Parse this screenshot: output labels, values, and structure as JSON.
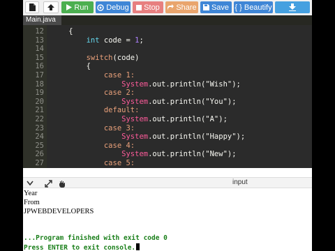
{
  "toolbar": {
    "file_icon": "file-icon",
    "upload_icon": "upload-icon",
    "run_label": "Run",
    "debug_label": "Debug",
    "stop_label": "Stop",
    "share_label": "Share",
    "save_label": "Save",
    "beautify_label": "{ } Beautify",
    "download_icon": "download-icon"
  },
  "editor": {
    "tab": "Main.java",
    "lines": [
      {
        "n": "12",
        "tokens": [
          {
            "t": "    {",
            "c": ""
          }
        ]
      },
      {
        "n": "13",
        "tokens": [
          {
            "t": "        ",
            "c": ""
          },
          {
            "t": "int",
            "c": "kw"
          },
          {
            "t": " code = ",
            "c": ""
          },
          {
            "t": "1",
            "c": "num"
          },
          {
            "t": ";",
            "c": ""
          }
        ]
      },
      {
        "n": "14",
        "tokens": [
          {
            "t": "",
            "c": ""
          }
        ]
      },
      {
        "n": "15",
        "tokens": [
          {
            "t": "        ",
            "c": ""
          },
          {
            "t": "switch",
            "c": "ctl2"
          },
          {
            "t": "(code)",
            "c": ""
          }
        ]
      },
      {
        "n": "16",
        "tokens": [
          {
            "t": "        {",
            "c": ""
          }
        ]
      },
      {
        "n": "17",
        "tokens": [
          {
            "t": "            ",
            "c": ""
          },
          {
            "t": "case 1:",
            "c": "ctl2"
          }
        ]
      },
      {
        "n": "18",
        "tokens": [
          {
            "t": "                ",
            "c": ""
          },
          {
            "t": "System",
            "c": "cls"
          },
          {
            "t": ".out.println(",
            "c": ""
          },
          {
            "t": "\"Wish\"",
            "c": ""
          },
          {
            "t": ");",
            "c": ""
          }
        ]
      },
      {
        "n": "19",
        "tokens": [
          {
            "t": "            ",
            "c": ""
          },
          {
            "t": "case 2:",
            "c": "ctl2"
          }
        ]
      },
      {
        "n": "20",
        "tokens": [
          {
            "t": "                ",
            "c": ""
          },
          {
            "t": "System",
            "c": "cls"
          },
          {
            "t": ".out.println(",
            "c": ""
          },
          {
            "t": "\"You\"",
            "c": ""
          },
          {
            "t": ");",
            "c": ""
          }
        ]
      },
      {
        "n": "21",
        "tokens": [
          {
            "t": "            ",
            "c": ""
          },
          {
            "t": "default:",
            "c": "ctl2"
          }
        ]
      },
      {
        "n": "22",
        "tokens": [
          {
            "t": "                ",
            "c": ""
          },
          {
            "t": "System",
            "c": "cls"
          },
          {
            "t": ".out.println(",
            "c": ""
          },
          {
            "t": "\"A\"",
            "c": ""
          },
          {
            "t": ");",
            "c": ""
          }
        ]
      },
      {
        "n": "23",
        "tokens": [
          {
            "t": "            ",
            "c": ""
          },
          {
            "t": "case 3:",
            "c": "ctl2"
          }
        ]
      },
      {
        "n": "24",
        "tokens": [
          {
            "t": "                ",
            "c": ""
          },
          {
            "t": "System",
            "c": "cls"
          },
          {
            "t": ".out.println(",
            "c": ""
          },
          {
            "t": "\"Happy\"",
            "c": ""
          },
          {
            "t": ");",
            "c": ""
          }
        ]
      },
      {
        "n": "25",
        "tokens": [
          {
            "t": "            ",
            "c": ""
          },
          {
            "t": "case 4:",
            "c": "ctl2"
          }
        ]
      },
      {
        "n": "26",
        "tokens": [
          {
            "t": "                ",
            "c": ""
          },
          {
            "t": "System",
            "c": "cls"
          },
          {
            "t": ".out.println(",
            "c": ""
          },
          {
            "t": "\"New\"",
            "c": ""
          },
          {
            "t": ");",
            "c": ""
          }
        ]
      },
      {
        "n": "27",
        "tokens": [
          {
            "t": "            ",
            "c": ""
          },
          {
            "t": "case 5:",
            "c": "ctl2"
          }
        ]
      }
    ]
  },
  "panel": {
    "expand_icon": "expand-icon",
    "stop_icon": "stop-icon",
    "input_label": "input"
  },
  "console": {
    "output": [
      "Year",
      "From",
      "JPWEBDEVELOPERS"
    ],
    "finished": "...Program finished with exit code 0",
    "prompt": "Press ENTER to exit console."
  },
  "colors": {
    "run": "#4caf50",
    "debug": "#3f86d6",
    "stop": "#e77f7f",
    "share": "#e9a56d",
    "editor_bg": "#2b2b2b",
    "console_text": "#1a7f1a"
  }
}
